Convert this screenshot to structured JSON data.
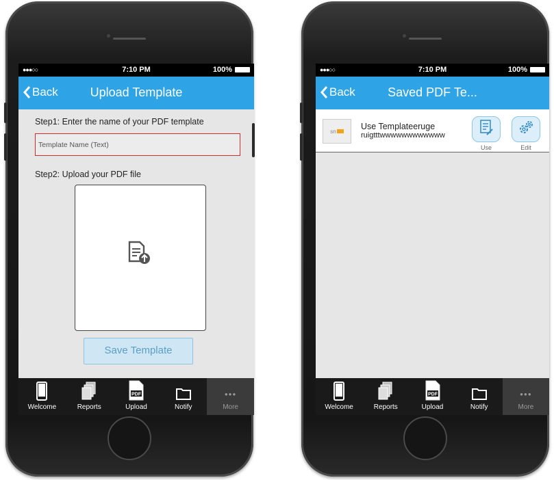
{
  "status_bar": {
    "signal": "●●●○○",
    "time": "7:10 PM",
    "battery": "100%"
  },
  "left_screen": {
    "back_label": "Back",
    "title": "Upload Template",
    "step1": "Step1: Enter the name of your PDF template",
    "template_name_placeholder": "Template Name (Text)",
    "step2": "Step2: Upload your PDF file",
    "save_button": "Save Template"
  },
  "right_screen": {
    "back_label": "Back",
    "title": "Saved PDF Te...",
    "items": [
      {
        "thumb_text": "sn",
        "line1": "Use Templateeruge",
        "line2": "ruigtttwwwwwwwwwwww",
        "use_label": "Use",
        "edit_label": "Edit"
      }
    ]
  },
  "tabbar": {
    "tabs": [
      {
        "label": "Welcome",
        "icon": "phone-icon"
      },
      {
        "label": "Reports",
        "icon": "documents-icon"
      },
      {
        "label": "Upload",
        "icon": "pdf-icon",
        "icon_text": "PDF"
      },
      {
        "label": "Notify",
        "icon": "folder-icon"
      },
      {
        "label": "More",
        "icon": "more-dots-icon",
        "icon_text": "●●●"
      }
    ]
  },
  "colors": {
    "nav_bar": "#2ea4e6",
    "screen_bg": "#e6e6e6",
    "input_border": "#d22b2b",
    "save_button_bg": "#cfe6f4",
    "tab_bar": "#1a1a1a"
  }
}
